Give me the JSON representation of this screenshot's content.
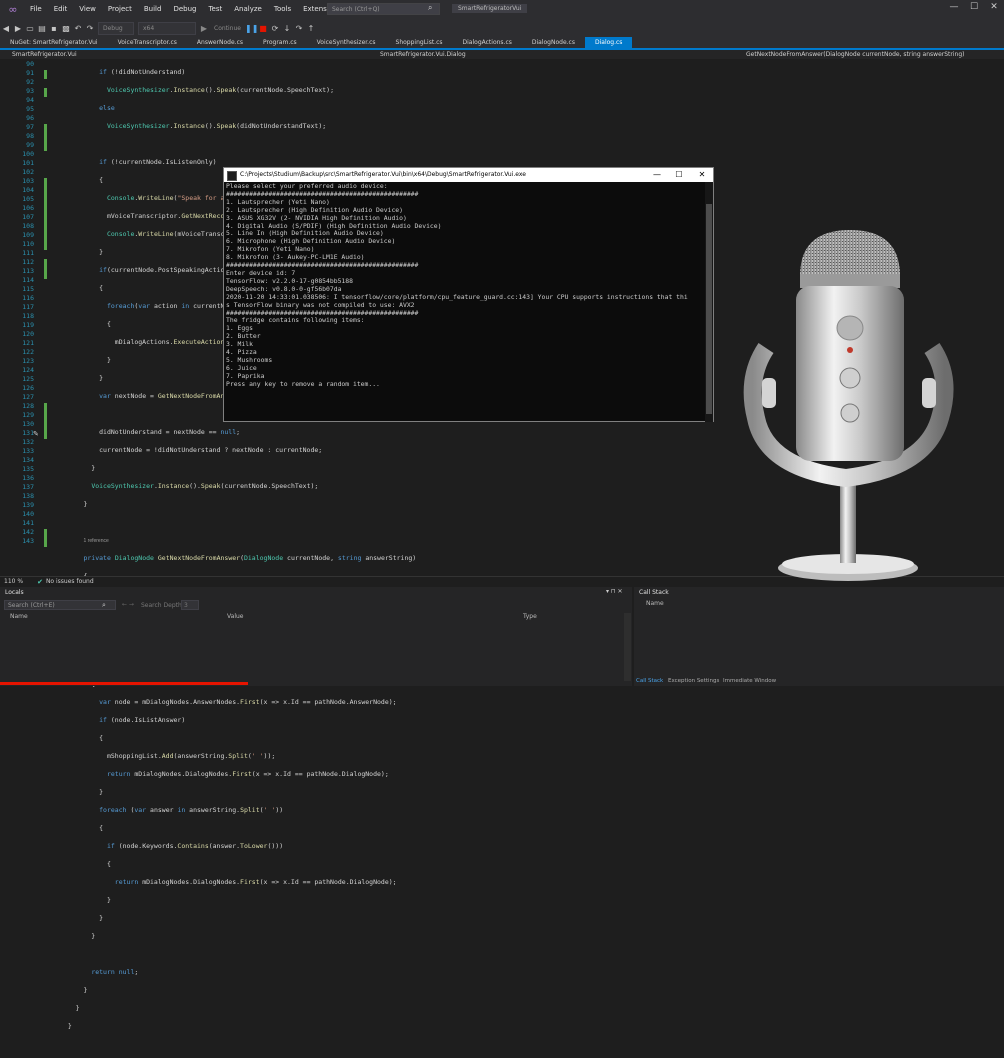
{
  "menu": {
    "items": [
      "File",
      "Edit",
      "View",
      "Project",
      "Build",
      "Debug",
      "Test",
      "Analyze",
      "Tools",
      "Extensions",
      "Window",
      "Help"
    ],
    "search_placeholder": "Search (Ctrl+Q)",
    "solution_name": "SmartRefrigeratorVui"
  },
  "toolbar": {
    "config": "Debug",
    "platform": "x64",
    "continue_label": "Continue"
  },
  "tabs": [
    {
      "label": "NuGet: SmartRefrigerator.Vui",
      "active": false
    },
    {
      "label": "VoiceTranscriptor.cs",
      "active": false
    },
    {
      "label": "AnswerNode.cs",
      "active": false
    },
    {
      "label": "Program.cs",
      "active": false
    },
    {
      "label": "VoiceSynthesizer.cs",
      "active": false
    },
    {
      "label": "ShoppingList.cs",
      "active": false
    },
    {
      "label": "DialogActions.cs",
      "active": false
    },
    {
      "label": "DialogNode.cs",
      "active": false
    },
    {
      "label": "Dialog.cs",
      "active": true
    }
  ],
  "navbar": {
    "project": "SmartRefrigerator.Vui",
    "class": "SmartRefrigerator.Vui.Dialog",
    "member": "GetNextNodeFromAnswer(DialogNode currentNode, string answerString)"
  },
  "editor": {
    "first_line": 90,
    "last_line": 143,
    "codelens_hint": "1 reference"
  },
  "console": {
    "title": "C:\\Projects\\Studium\\Backup\\src\\SmartRefrigerator.Vui\\bin\\x64\\Debug\\SmartRefrigerator.Vui.exe",
    "lines": [
      "Please select your preferred audio device:",
      "##################################################",
      "1. Lautsprecher (Yeti Nano)",
      "2. Lautsprecher (High Definition Audio Device)",
      "3. ASUS XG32V (2- NVIDIA High Definition Audio)",
      "4. Digital Audio (S/PDIF) (High Definition Audio Device)",
      "5. Line In (High Definition Audio Device)",
      "6. Microphone (High Definition Audio Device)",
      "7. Mikrofon (Yeti Nano)",
      "8. Mikrofon (3- Aukey-PC-LM1E Audio)",
      "##################################################",
      "Enter device id: 7",
      "TensorFlow: v2.2.0-17-g0854bb5188",
      "DeepSpeech: v0.8.0-0-gf56b07da",
      "2020-11-20 14:33:01.038506: I tensorflow/core/platform/cpu_feature_guard.cc:143] Your CPU supports instructions that thi",
      "s TensorFlow binary was not compiled to use: AVX2",
      "##################################################",
      "The fridge contains following items:",
      "1. Eggs",
      "2. Butter",
      "3. Milk",
      "4. Pizza",
      "5. Mushrooms",
      "6. Juice",
      "7. Paprika",
      "Press any key to remove a random item..."
    ]
  },
  "status": {
    "zoom": "110 %",
    "issues": "No issues found"
  },
  "locals_panel": {
    "title": "Locals",
    "search_placeholder": "Search (Ctrl+E)",
    "search_depth_label": "Search Depth:",
    "search_depth_value": "3",
    "columns": [
      "Name",
      "Value",
      "Type"
    ]
  },
  "callstack_panel": {
    "title": "Call Stack",
    "columns": [
      "Name"
    ],
    "bottom_tabs": [
      "Call Stack",
      "Exception Settings",
      "Immediate Window"
    ]
  },
  "colors": {
    "accent": "#007acc",
    "background": "#1e1e1e",
    "console_bg": "#0c0c0c"
  }
}
